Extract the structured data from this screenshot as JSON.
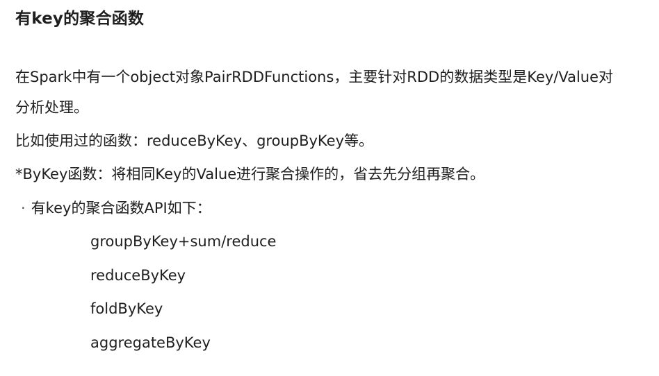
{
  "heading": "有key的聚合函数",
  "paragraphs": {
    "p1_line1": "在Spark中有一个object对象PairRDDFunctions，主要针对RDD的数据类型是Key/Value对",
    "p1_line2": "分析处理。",
    "p2": "比如使用过的函数：reduceByKey、groupByKey等。",
    "p3": "*ByKey函数：将相同Key的Value进行聚合操作的，省去先分组再聚合。"
  },
  "bullet": {
    "symbol": "·",
    "text": "有key的聚合函数API如下："
  },
  "api_items": [
    "groupByKey+sum/reduce",
    "reduceByKey",
    "foldByKey",
    "aggregateByKey"
  ]
}
